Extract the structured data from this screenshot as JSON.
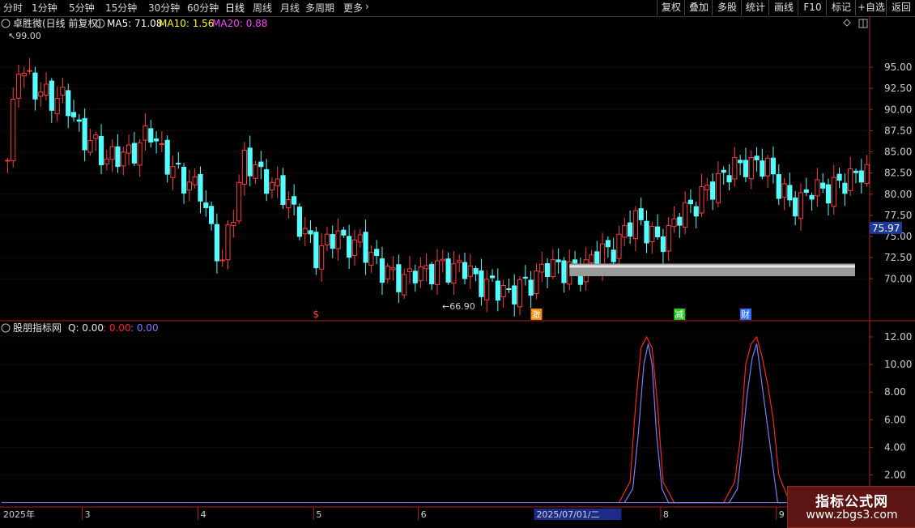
{
  "toolbar": {
    "timeframes": [
      "分时",
      "1分钟",
      "5分钟",
      "15分钟",
      "30分钟",
      "60分钟",
      "日线",
      "周线",
      "月线",
      "多周期",
      "更多"
    ],
    "active": "日线",
    "buttons": [
      "复权",
      "叠加",
      "多股",
      "统计",
      "画线",
      "F10",
      "标记",
      "+自选",
      "返回"
    ]
  },
  "main_header": {
    "title": "卓胜微(日线 前复权)",
    "ma5": "MA5: 71.08",
    "ma10": "MA10: 1.56",
    "ma20": "MA20: 0.88"
  },
  "indicator_header": {
    "name": "股朋指标网",
    "q": "Q: 0.00",
    "v2": ": 0.00",
    "v3": ": 0.00"
  },
  "colors": {
    "up": "#ff3b3b",
    "down": "#54ffff",
    "axis_red": "#b02020",
    "ma5": "#ffffff",
    "ma10": "#ffff00",
    "ma20": "#ff40ff",
    "indicator_red": "#ff2020",
    "indicator_blue": "#7b7bff",
    "current_price_bg": "#1c3a9a"
  },
  "chart_data": [
    {
      "type": "candlestick",
      "ylim": [
        66,
        101
      ],
      "y_ticks": [
        "95.00",
        "92.50",
        "90.00",
        "87.50",
        "85.00",
        "82.50",
        "80.00",
        "77.50",
        "75.00",
        "72.50",
        "70.00"
      ],
      "current_price": "75.97",
      "max_label": "99.00",
      "min_label": "66.90",
      "band": [
        70.3,
        71.8
      ],
      "event_markers": [
        {
          "text": "$",
          "color": "#ff4040",
          "index": 56
        },
        {
          "text": "激",
          "color": "#ff8c00",
          "index": 96
        },
        {
          "text": "减",
          "color": "#22cc22",
          "index": 122
        },
        {
          "text": "财",
          "color": "#2f6fff",
          "index": 134
        }
      ],
      "x_labels": [
        {
          "text": "2025年",
          "index": 0
        },
        {
          "text": "3",
          "index": 14
        },
        {
          "text": "4",
          "index": 35
        },
        {
          "text": "5",
          "index": 56
        },
        {
          "text": "6",
          "index": 75
        },
        {
          "text": "2025/07/01/二",
          "index": 96
        },
        {
          "text": "8",
          "index": 119
        },
        {
          "text": "9",
          "index": 140
        }
      ]
    },
    {
      "type": "line",
      "ylim": [
        0,
        13
      ],
      "y_ticks": [
        "12.00",
        "10.00",
        "8.00",
        "6.00",
        "4.00",
        "2.00"
      ],
      "series": [
        {
          "values": [
            [
              111,
              0
            ],
            [
              113,
              1.5
            ],
            [
              114,
              7
            ],
            [
              115,
              11.2
            ],
            [
              116,
              12
            ],
            [
              117,
              11.2
            ],
            [
              118,
              7
            ],
            [
              119,
              1.5
            ],
            [
              121,
              0
            ],
            [
              130,
              0
            ],
            [
              132,
              1.5
            ],
            [
              133,
              4.5
            ],
            [
              134,
              10
            ],
            [
              135,
              11.5
            ],
            [
              136,
              12
            ],
            [
              137,
              10.5
            ],
            [
              138,
              8.5
            ],
            [
              139,
              6
            ],
            [
              140,
              2
            ],
            [
              142,
              0
            ]
          ]
        },
        {
          "values": [
            [
              112,
              0
            ],
            [
              113.5,
              1
            ],
            [
              114.5,
              5
            ],
            [
              115.5,
              10
            ],
            [
              116.3,
              11.5
            ],
            [
              117,
              10
            ],
            [
              117.8,
              5
            ],
            [
              118.8,
              1
            ],
            [
              120,
              0
            ],
            [
              131,
              0
            ],
            [
              132.5,
              1
            ],
            [
              133.3,
              4
            ],
            [
              134.3,
              8
            ],
            [
              135.2,
              10.5
            ],
            [
              136,
              11.5
            ],
            [
              136.8,
              9
            ],
            [
              137.8,
              6
            ],
            [
              138.8,
              3
            ],
            [
              139.8,
              0
            ],
            [
              141,
              0
            ]
          ]
        }
      ]
    }
  ],
  "watermark": {
    "line1": "指标公式网",
    "line2": "www.zbgs3.com"
  }
}
